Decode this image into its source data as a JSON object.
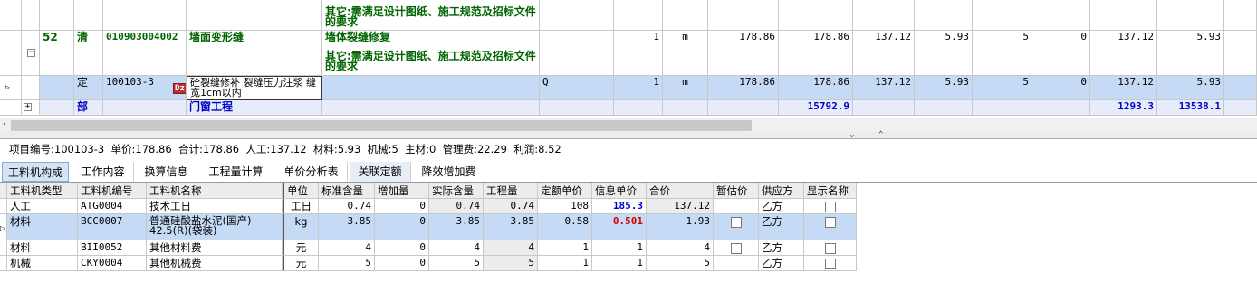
{
  "top_grid": {
    "row0": {
      "desc": "其它:需满足设计图纸、施工规范及招标文件的要求"
    },
    "row1": {
      "seq": "52",
      "type": "清",
      "code": "010903004002",
      "name": "墙面变形缝",
      "desc1": "墙体裂缝修复",
      "desc2": "其它:需满足设计图纸、施工规范及招标文件的要求",
      "qty": "1",
      "unit": "m",
      "c1": "178.86",
      "c2": "178.86",
      "c3": "137.12",
      "c4": "5.93",
      "c5": "5",
      "c6": "0",
      "c7": "137.12",
      "c8": "5.93"
    },
    "row2": {
      "type": "定",
      "code": "100103-3",
      "tag": "Dz",
      "name": "砼裂缝修补 裂缝压力注浆 缝宽1cm以内",
      "formula": "Q",
      "qty": "1",
      "unit": "m",
      "c1": "178.86",
      "c2": "178.86",
      "c3": "137.12",
      "c4": "5.93",
      "c5": "5",
      "c6": "0",
      "c7": "137.12",
      "c8": "5.93"
    },
    "row3": {
      "type": "部",
      "name": "门窗工程",
      "c2": "15792.9",
      "c7": "1293.3",
      "c8": "13538.1"
    }
  },
  "info_bar": "项目编号:100103-3  单价:178.86  合计:178.86  人工:137.12  材料:5.93  机械:5  主材:0  管理费:22.29  利润:8.52",
  "tabs": [
    "工料机构成",
    "工作内容",
    "换算信息",
    "工程量计算",
    "单价分析表",
    "关联定额",
    "降效增加费"
  ],
  "bottom_grid": {
    "headers": [
      "工料机类型",
      "工料机编号",
      "工料机名称",
      "单位",
      "标准含量",
      "增加量",
      "实际含量",
      "工程量",
      "定额单价",
      "信息单价",
      "合价",
      "暂估价",
      "供应方",
      "显示名称"
    ],
    "rows": [
      {
        "type": "人工",
        "code": "ATG0004",
        "name": "技术工日",
        "unit": "工日",
        "std": "0.74",
        "add": "0",
        "act": "0.74",
        "qty": "0.74",
        "price": "108",
        "info": "185.3",
        "total": "137.12",
        "supplier": "乙方"
      },
      {
        "type": "材料",
        "code": "BCC0007",
        "name": "普通硅酸盐水泥(国产) 42.5(R)(袋装)",
        "unit": "kg",
        "std": "3.85",
        "add": "0",
        "act": "3.85",
        "qty": "3.85",
        "price": "0.58",
        "info": "0.501",
        "total": "1.93",
        "supplier": "乙方"
      },
      {
        "type": "材料",
        "code": "BII0052",
        "name": "其他材料费",
        "unit": "元",
        "std": "4",
        "add": "0",
        "act": "4",
        "qty": "4",
        "price": "1",
        "info": "1",
        "total": "4",
        "supplier": "乙方"
      },
      {
        "type": "机械",
        "code": "CKY0004",
        "name": "其他机械费",
        "unit": "元",
        "std": "5",
        "add": "0",
        "act": "5",
        "qty": "5",
        "price": "1",
        "info": "1",
        "total": "5",
        "supplier": "乙方"
      }
    ]
  },
  "colors": {
    "selected_row": "#c5daf4",
    "item_green": "#006400",
    "blue_value": "#0000cc",
    "red_value": "#d40000"
  }
}
